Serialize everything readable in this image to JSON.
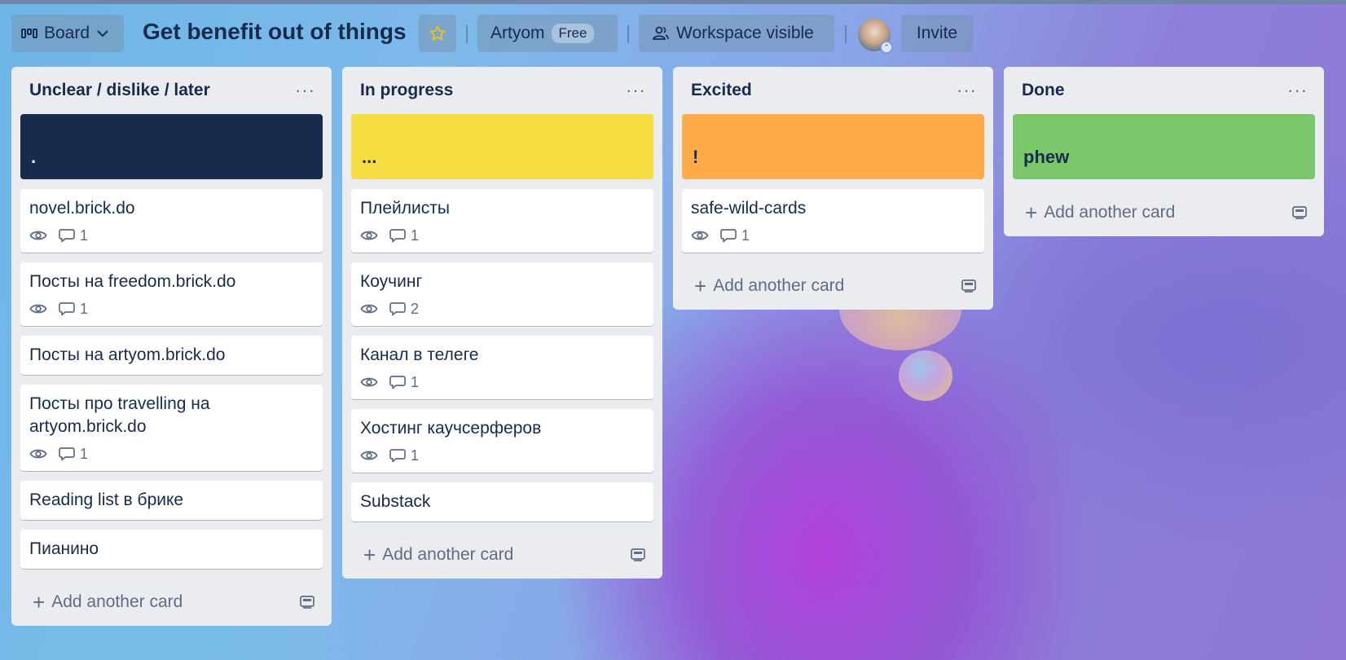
{
  "header": {
    "board_label": "Board",
    "board_title": "Get benefit out of things",
    "workspace_name": "Artyom",
    "plan_badge": "Free",
    "visibility_label": "Workspace visible",
    "invite_label": "Invite"
  },
  "add_card_label": "Add another card",
  "lists": [
    {
      "title": "Unclear / dislike / later",
      "cover": {
        "text": ".",
        "color": "#172b4d",
        "text_color": "#ffffff"
      },
      "cards": [
        {
          "title": "novel.brick.do",
          "watch": true,
          "comments": "1"
        },
        {
          "title": "Посты на freedom.brick.do",
          "watch": true,
          "comments": "1"
        },
        {
          "title": "Посты на artyom.brick.do"
        },
        {
          "title": "Посты про travelling на artyom.brick.do",
          "watch": true,
          "comments": "1"
        },
        {
          "title": "Reading list в брике"
        },
        {
          "title": "Пианино"
        }
      ]
    },
    {
      "title": "In progress",
      "cover": {
        "text": "...",
        "color": "#f5dd42",
        "text_color": "#172b4d"
      },
      "cards": [
        {
          "title": "Плейлисты",
          "watch": true,
          "comments": "1"
        },
        {
          "title": "Коучинг",
          "watch": true,
          "comments": "2"
        },
        {
          "title": "Канал в телеге",
          "watch": true,
          "comments": "1"
        },
        {
          "title": "Хостинг каучсерферов",
          "watch": true,
          "comments": "1"
        },
        {
          "title": "Substack"
        }
      ]
    },
    {
      "title": "Excited",
      "cover": {
        "text": "!",
        "color": "#ffab4a",
        "text_color": "#172b4d"
      },
      "cards": [
        {
          "title": "safe-wild-cards",
          "watch": true,
          "comments": "1"
        }
      ]
    },
    {
      "title": "Done",
      "cover": {
        "text": "phew",
        "color": "#7bc86c",
        "text_color": "#172b4d"
      },
      "cards": []
    }
  ]
}
